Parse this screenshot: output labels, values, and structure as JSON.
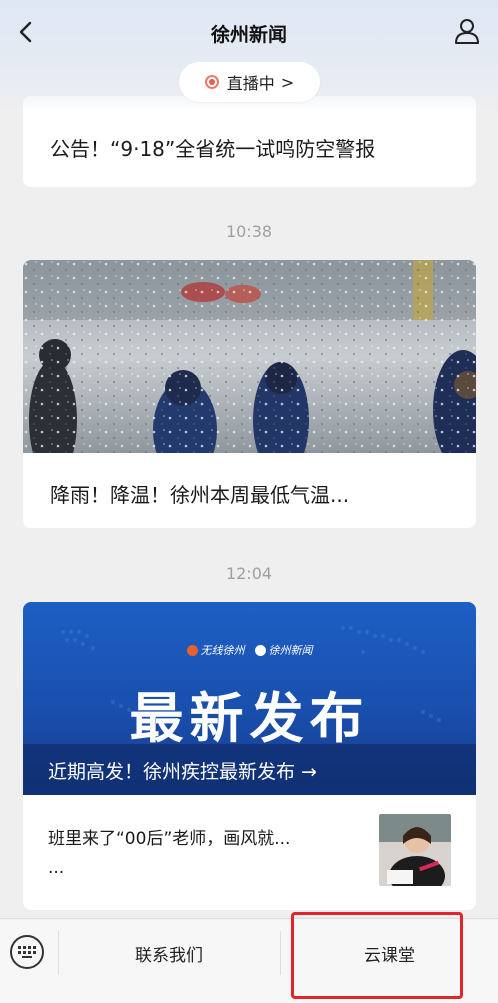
{
  "header": {
    "title": "徐州新闻",
    "live_label": "直播中",
    "live_chevron": ">"
  },
  "feed": {
    "item1": {
      "title": "公告！“9·18”全省统一试鸣防空警报"
    },
    "time2": "10:38",
    "item2": {
      "title": "降雨！降温！徐州本周最低气温..."
    },
    "time3": "12:04",
    "item3": {
      "banner_logo1": "无线徐州",
      "banner_logo2": "徐州新闻",
      "banner_headline": "最新发布",
      "banner_sub": "近期高发！徐州疾控最新发布 →",
      "text_line1": "班里来了“00后”老师，画风就...",
      "text_line2": "..."
    }
  },
  "bottom_menu": {
    "contact_label": "联系我们",
    "course_label": "云课堂"
  },
  "colors": {
    "accent_live": "#ec5a4b",
    "highlight_box": "#e2242a",
    "banner_blue": "#1d5fc4"
  },
  "icons": {
    "back": "chevron-left-icon",
    "user": "user-icon",
    "live": "live-dot-icon",
    "keyboard": "keyboard-icon"
  }
}
